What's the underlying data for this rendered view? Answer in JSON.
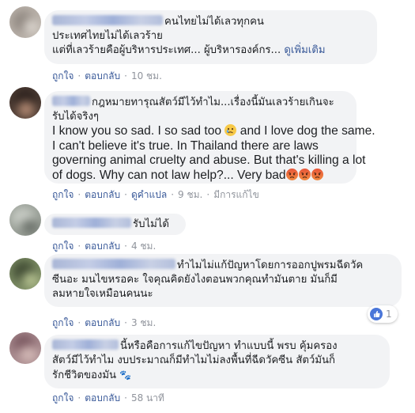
{
  "actions": {
    "like": "ถูกใจ",
    "reply": "ตอบกลับ",
    "translate": "ดูคำแปล",
    "edited": "มีการแก้ไข"
  },
  "comments": [
    {
      "lines": [
        "คนไทยไม่ได้เลวทุกคน",
        "ประเทศไทยไม่ได้เลวร้าย",
        "แต่ที่เลวร้ายคือผู้บริหารประเทศ... ผู้บริหารองค์กร..."
      ],
      "see_more": "ดูเพิ่มเติม",
      "time": "10 ชม."
    },
    {
      "lines": [
        "กฎหมายทารุณสัตว์มีไว้ทำไม...เรื่องนี้มันเลวร้ายเกินจะ",
        "รับได้จริงๆ"
      ],
      "eng_lines": [
        "I know you so sad. I so sad too",
        "and I love dog the same.",
        "I can't believe it's true. In Thailand there are laws",
        "governing animal cruelty and abuse. But that's killing a lot",
        "of dogs. Why can not law help?... Very bad"
      ],
      "time": "9 ชม."
    },
    {
      "lines": [
        "รับไม่ได้"
      ],
      "time": "4 ชม."
    },
    {
      "lines": [
        "ทำไมไม่แก้ปัญหาโดยการออกปูพรมฉีดวัค",
        "ซีนอะ มนไขหรอคะ ใจคุณคิดยังไงตอนพวกคุณทำมันตาย มันก็มี",
        "ลมหายใจเหมือนคนนะ"
      ],
      "time": "3 ชม.",
      "reaction_count": "1"
    },
    {
      "lines": [
        "นี้หรือคือการแก้ไขปัญหา ทำแบบนี้ พรบ คุ้มครอง",
        "สัตว์มีไว้ทำไม งบประมาณก็มีทำไมไม่ลงพื้นที่ฉีดวัคซีน สัตว์มันก็",
        "รักชีวิตของมัน"
      ],
      "time": "58 นาที"
    }
  ],
  "colors": {
    "bubble": "#f2f3f5",
    "link": "#385898",
    "meta": "#90949c",
    "like_blue": "#4a76d9"
  }
}
